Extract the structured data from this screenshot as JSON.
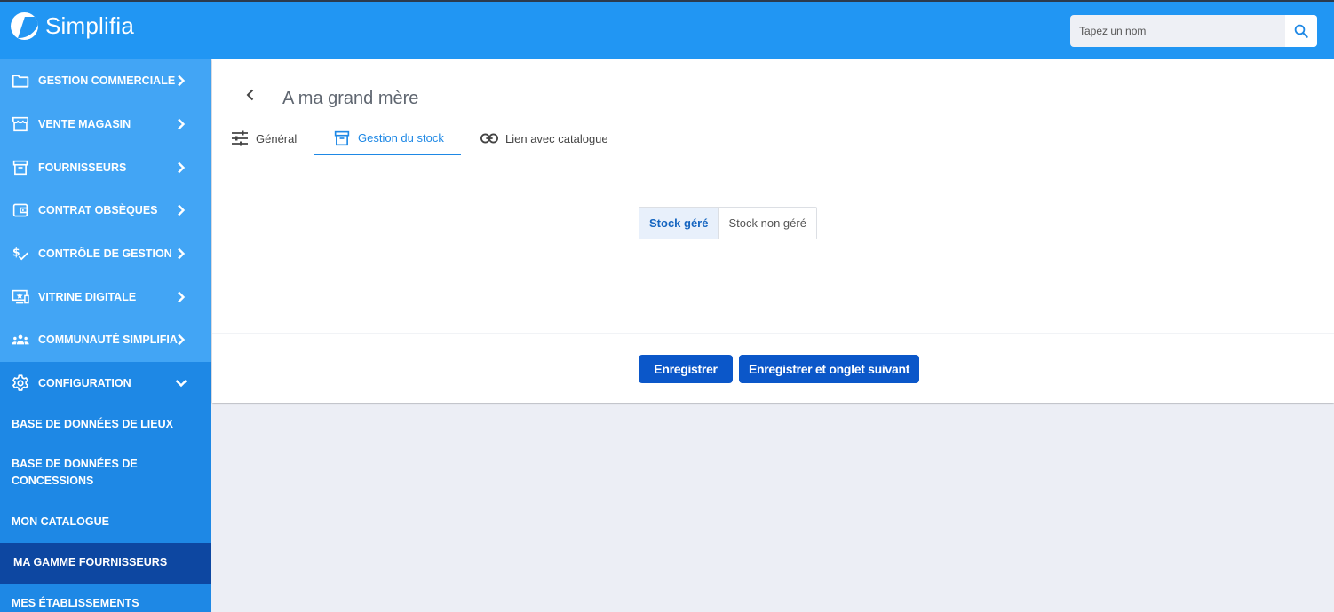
{
  "app": {
    "name": "Simplifia"
  },
  "search": {
    "placeholder": "Tapez un nom"
  },
  "sidebar": {
    "items": [
      {
        "label": "GESTION COMMERCIALE",
        "icon": "folder-icon"
      },
      {
        "label": "VENTE MAGASIN",
        "icon": "storefront-icon"
      },
      {
        "label": "FOURNISSEURS",
        "icon": "archive-box-icon"
      },
      {
        "label": "CONTRAT OBSÈQUES",
        "icon": "wallet-icon"
      },
      {
        "label": "CONTRÔLE DE GESTION",
        "icon": "dollar-check-icon"
      },
      {
        "label": "VITRINE DIGITALE",
        "icon": "monitor-star-icon"
      },
      {
        "label": "COMMUNAUTÉ SIMPLIFIA",
        "icon": "people-group-icon"
      },
      {
        "label": "CONFIGURATION",
        "icon": "gear-icon"
      }
    ],
    "sub_items": [
      {
        "label": "BASE DE DONNÉES DE LIEUX"
      },
      {
        "label": "BASE DE DONNÉES DE CONCESSIONS"
      },
      {
        "label": "MON CATALOGUE"
      },
      {
        "label": "MA GAMME FOURNISSEURS"
      },
      {
        "label": "MES ÉTABLISSEMENTS"
      }
    ]
  },
  "main": {
    "title": "A ma grand mère",
    "tabs": [
      {
        "label": "Général",
        "icon": "sliders-icon"
      },
      {
        "label": "Gestion du stock",
        "icon": "archive-box-icon"
      },
      {
        "label": "Lien avec catalogue",
        "icon": "link-icon"
      }
    ],
    "active_tab": "Gestion du stock",
    "stock_toggle": {
      "options": [
        "Stock géré",
        "Stock non géré"
      ],
      "selected": "Stock géré"
    },
    "buttons": {
      "save": "Enregistrer",
      "save_next": "Enregistrer et onglet suivant"
    }
  },
  "colors": {
    "header": "#2196f3",
    "sidebar": "#42a5f5",
    "sidebar_open": "#1e88e5",
    "sidebar_active": "#0d47a1",
    "primary_button": "#0b57c9"
  }
}
